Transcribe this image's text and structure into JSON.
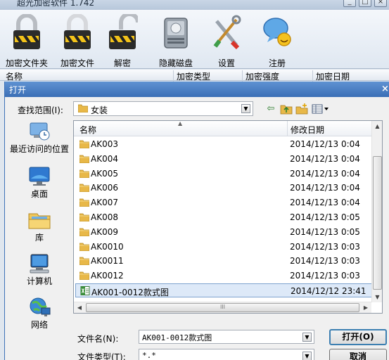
{
  "app": {
    "title": "超光加密软件 1.742",
    "win_buttons": [
      "_",
      "□",
      "×"
    ],
    "toolbar": [
      {
        "label": "加密文件夹",
        "icon": "padlock-closed-icon"
      },
      {
        "label": "加密文件",
        "icon": "padlock-closed-icon"
      },
      {
        "label": "解密",
        "icon": "padlock-open-icon"
      },
      {
        "label": "隐藏磁盘",
        "icon": "hard-disk-icon"
      },
      {
        "label": "设置",
        "icon": "tools-icon"
      },
      {
        "label": "注册",
        "icon": "register-bubble-icon"
      }
    ],
    "columns": [
      "名称",
      "加密类型",
      "加密强度",
      "加密日期"
    ]
  },
  "dialog": {
    "title": "打开",
    "close": "×",
    "look_in_label": "查找范围(I):",
    "look_in_value": "女装",
    "toolbar_icons": [
      "back-arrow-icon",
      "up-folder-icon",
      "new-folder-icon",
      "view-menu-icon"
    ],
    "places": [
      {
        "label": "最近访问的位置",
        "icon": "recent-places-icon"
      },
      {
        "label": "桌面",
        "icon": "desktop-icon"
      },
      {
        "label": "库",
        "icon": "libraries-icon"
      },
      {
        "label": "计算机",
        "icon": "computer-icon"
      },
      {
        "label": "网络",
        "icon": "network-icon"
      }
    ],
    "list": {
      "columns": [
        "名称",
        "修改日期"
      ],
      "rows": [
        {
          "name": "AK003",
          "date": "2014/12/13 0:04",
          "type": "folder"
        },
        {
          "name": "AK004",
          "date": "2014/12/13 0:04",
          "type": "folder"
        },
        {
          "name": "AK005",
          "date": "2014/12/13 0:04",
          "type": "folder"
        },
        {
          "name": "AK006",
          "date": "2014/12/13 0:04",
          "type": "folder"
        },
        {
          "name": "AK007",
          "date": "2014/12/13 0:04",
          "type": "folder"
        },
        {
          "name": "AK008",
          "date": "2014/12/13 0:05",
          "type": "folder"
        },
        {
          "name": "AK009",
          "date": "2014/12/13 0:05",
          "type": "folder"
        },
        {
          "name": "AK0010",
          "date": "2014/12/13 0:03",
          "type": "folder"
        },
        {
          "name": "AK0011",
          "date": "2014/12/13 0:03",
          "type": "folder"
        },
        {
          "name": "AK0012",
          "date": "2014/12/13 0:03",
          "type": "folder"
        },
        {
          "name": "AK001-0012款式图",
          "date": "2014/12/12 23:41",
          "type": "excel",
          "selected": true
        }
      ]
    },
    "filename_label": "文件名(N):",
    "filename_value": "AK001-0012款式图",
    "filetype_label": "文件类型(T):",
    "filetype_value": "*.*",
    "open_button": "打开(O)",
    "cancel_button": "取消"
  },
  "colors": {
    "dialog_title_bar": "#3b6fb6",
    "selection": "#dde9f8",
    "folder": "#e8b848"
  }
}
